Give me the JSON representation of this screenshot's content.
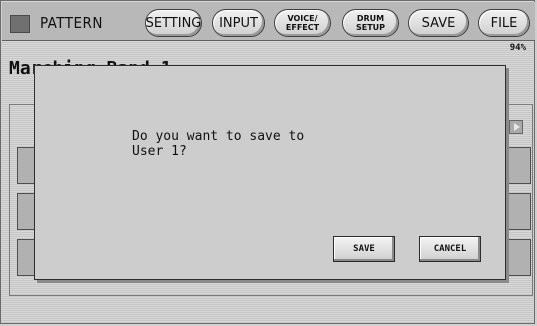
{
  "topbar": {
    "title": "PATTERN",
    "buttons": {
      "setting": "SETTING",
      "input": "INPUT",
      "voice_effect_line1": "VOICE/",
      "voice_effect_line2": "EFFECT",
      "drum_setup_line1": "DRUM",
      "drum_setup_line2": "SETUP",
      "save": "SAVE",
      "file": "FILE"
    }
  },
  "header": {
    "song_name": "Marching Band 1",
    "level": "94%"
  },
  "dialog": {
    "message_line1": "Do you want to save to",
    "message_line2": "User 1?",
    "save_label": "SAVE",
    "cancel_label": "CANCEL"
  },
  "icons": {
    "page": "page-icon",
    "play": "play-triangle-icon"
  }
}
